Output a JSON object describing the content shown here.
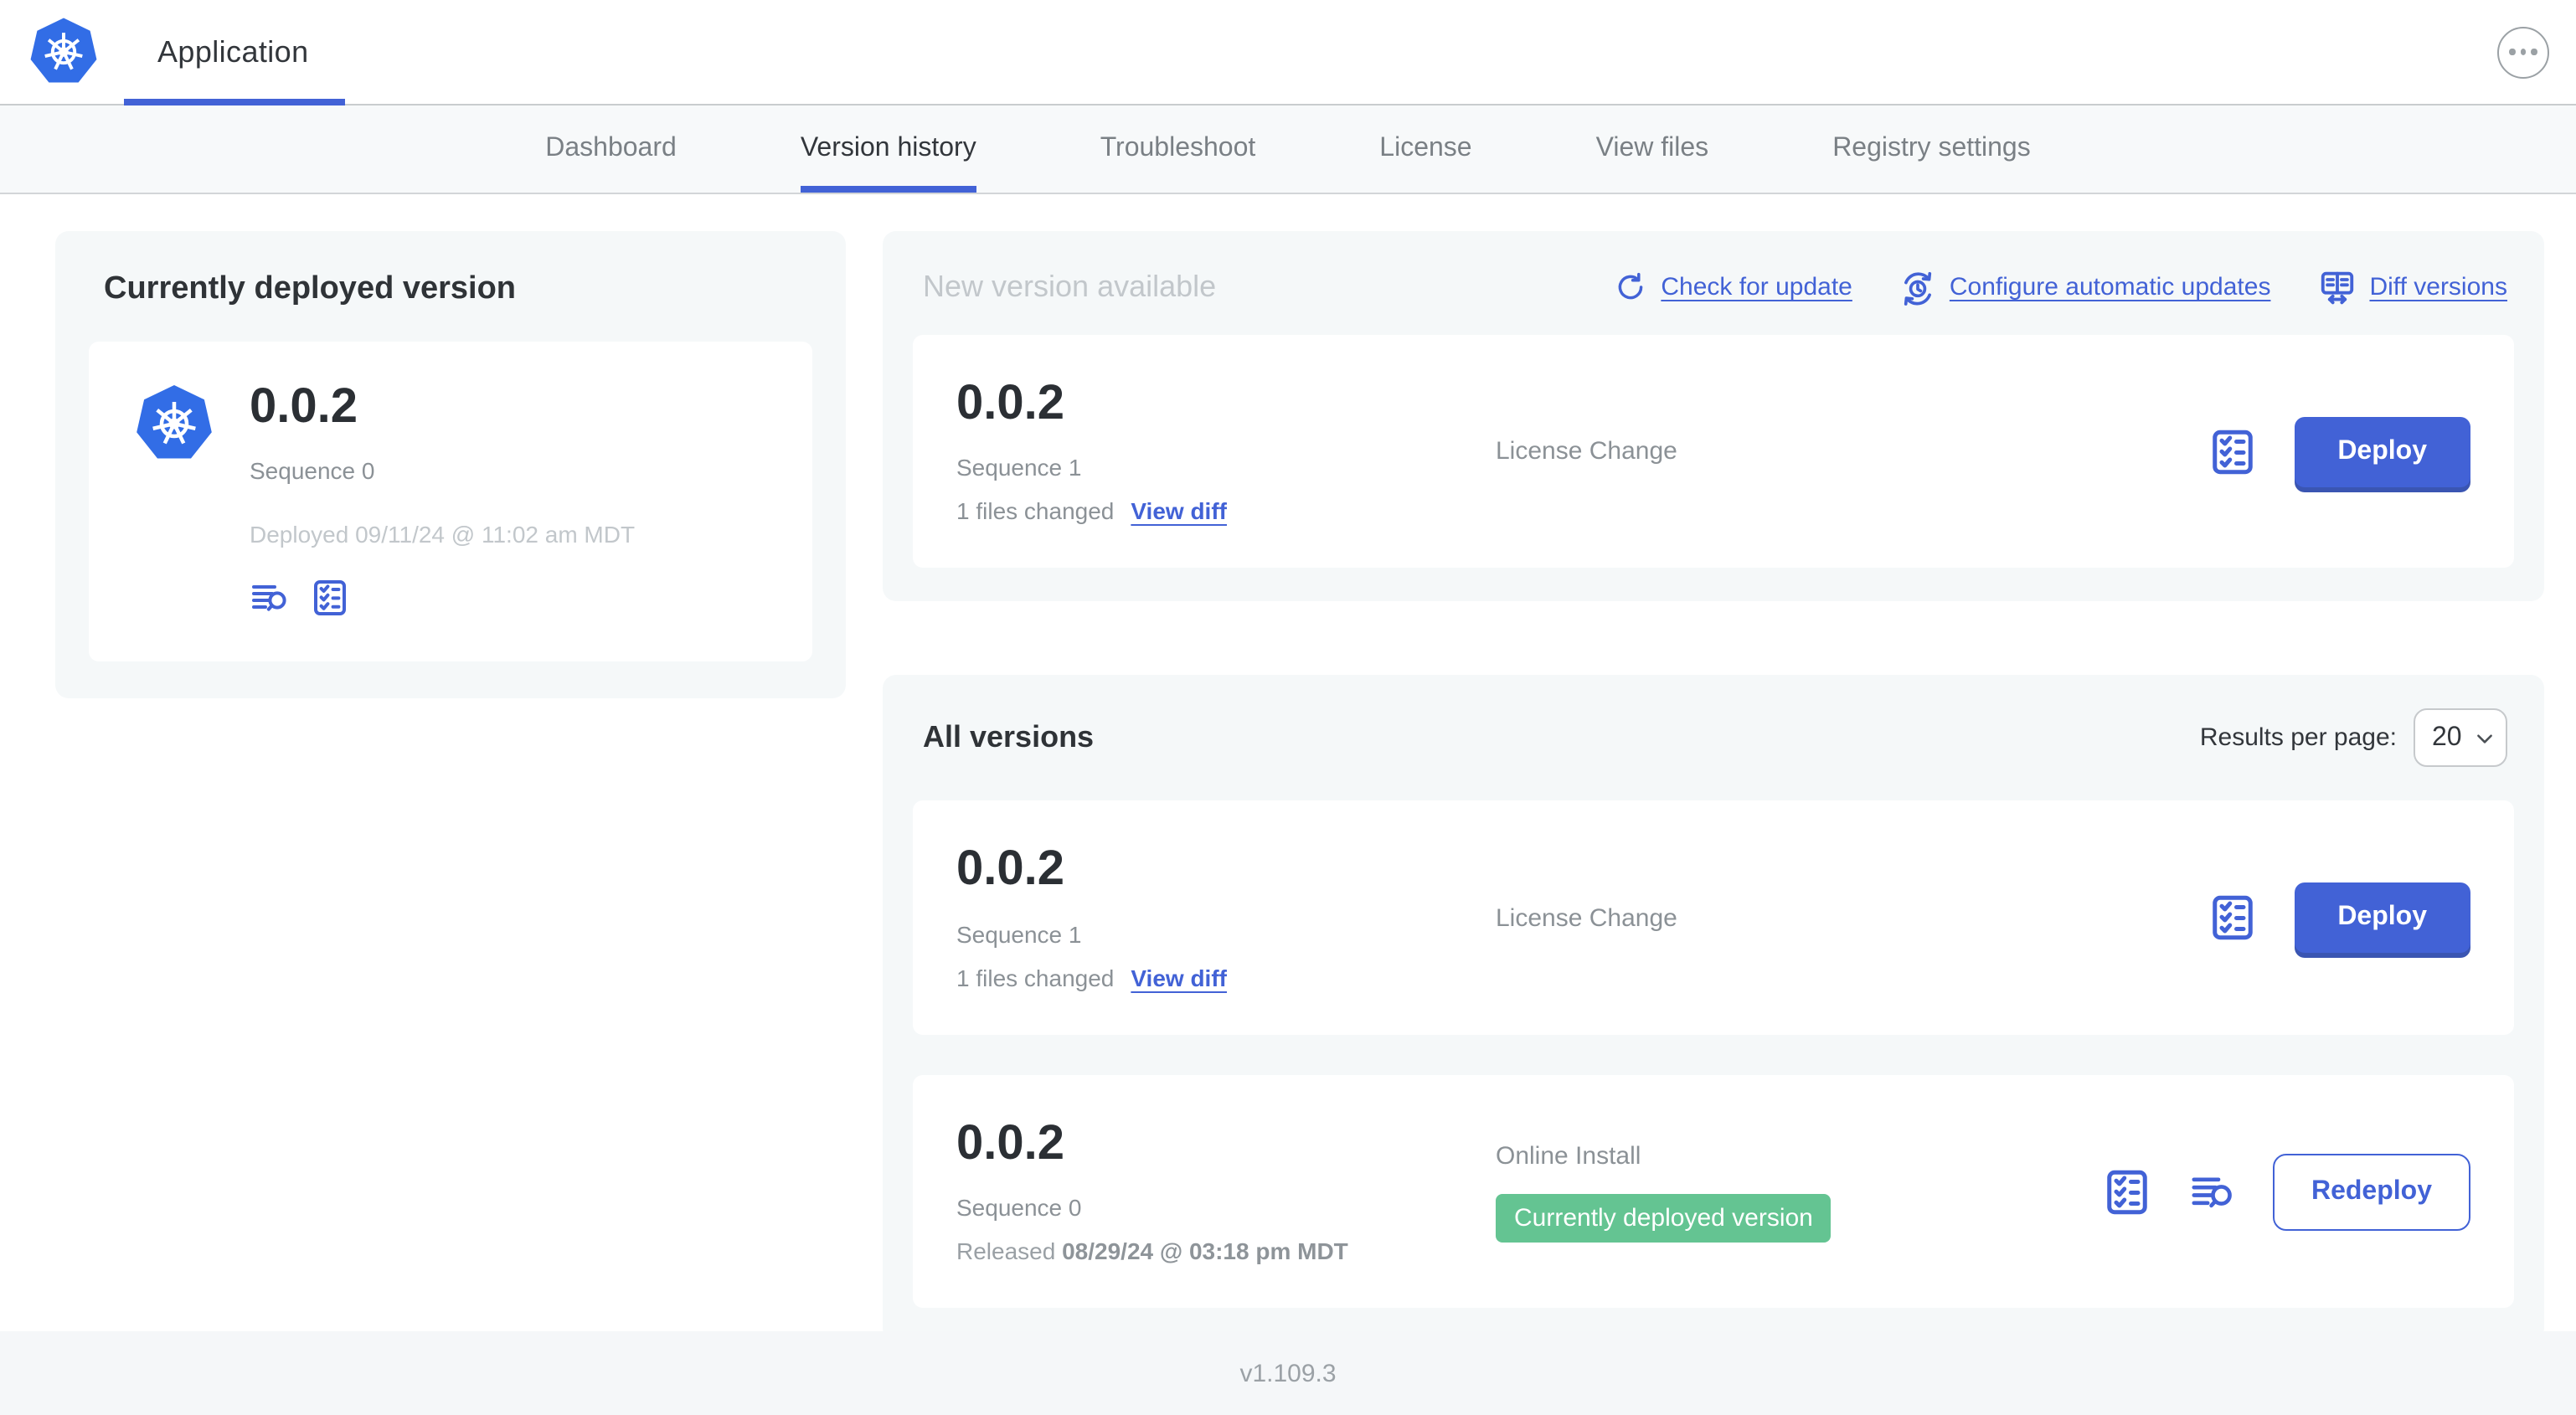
{
  "colors": {
    "accent_blue": "#4262d6",
    "logo_blue": "#326de6",
    "badge_green": "#64c492"
  },
  "header": {
    "app_title": "Application"
  },
  "nav": {
    "tabs": [
      {
        "label": "Dashboard"
      },
      {
        "label": "Version history"
      },
      {
        "label": "Troubleshoot"
      },
      {
        "label": "License"
      },
      {
        "label": "View files"
      },
      {
        "label": "Registry settings"
      }
    ]
  },
  "current": {
    "title": "Currently deployed version",
    "version": "0.0.2",
    "sequence": "Sequence 0",
    "deployed": "Deployed 09/11/24 @ 11:02 am MDT"
  },
  "newv": {
    "title": "New version available",
    "links": {
      "check_for_update": "Check for update",
      "configure": "Configure automatic updates",
      "diff": "Diff versions"
    },
    "row": {
      "version": "0.0.2",
      "sequence": "Sequence 1",
      "files_changed": "1 files changed",
      "view_diff": "View diff",
      "notes": "License Change",
      "deploy_label": "Deploy"
    }
  },
  "allv": {
    "title": "All versions",
    "results_per_page_label": "Results per page:",
    "results_per_page_value": "20",
    "rows": [
      {
        "version": "0.0.2",
        "sequence": "Sequence 1",
        "files_changed": "1 files changed",
        "view_diff": "View diff",
        "notes": "License Change",
        "deploy_label": "Deploy"
      },
      {
        "version": "0.0.2",
        "sequence": "Sequence 0",
        "released_label": "Released",
        "released_date": "08/29/24 @ 03:18 pm MDT",
        "notes": "Online Install",
        "badge": "Currently deployed version",
        "redeploy_label": "Redeploy"
      }
    ]
  },
  "footer": {
    "version": "v1.109.3"
  }
}
